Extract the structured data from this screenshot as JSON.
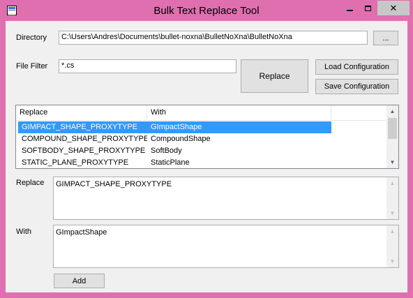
{
  "window": {
    "title": "Bulk Text Replace Tool",
    "controls": {
      "minimize_icon": "minimize-icon",
      "maximize_icon": "maximize-icon",
      "close_label": "✕"
    }
  },
  "directory": {
    "label": "Directory",
    "value": "C:\\Users\\Andres\\Documents\\bullet-noxna\\BulletNoXna\\BulletNoXna",
    "browse_label": "..."
  },
  "file_filter": {
    "label": "File Filter",
    "value": "*.cs"
  },
  "buttons": {
    "replace": "Replace",
    "load_configuration": "Load Configuration",
    "save_configuration": "Save Configuration",
    "add": "Add"
  },
  "list": {
    "columns": [
      "Replace",
      "With"
    ],
    "rows": [
      {
        "replace": "GIMPACT_SHAPE_PROXYTYPE",
        "with": "GImpactShape",
        "selected": true
      },
      {
        "replace": "COMPOUND_SHAPE_PROXYTYPE",
        "with": "CompoundShape",
        "selected": false
      },
      {
        "replace": "SOFTBODY_SHAPE_PROXYTYPE",
        "with": "SoftBody",
        "selected": false
      },
      {
        "replace": "STATIC_PLANE_PROXYTYPE",
        "with": "StaticPlane",
        "selected": false
      }
    ]
  },
  "editor": {
    "replace_label": "Replace",
    "replace_value": "GIMPACT_SHAPE_PROXYTYPE",
    "with_label": "With",
    "with_value": "GImpactShape"
  },
  "colors": {
    "window_frame": "#e06fb0",
    "selection": "#3399ff",
    "client_bg": "#f0f0f0"
  }
}
